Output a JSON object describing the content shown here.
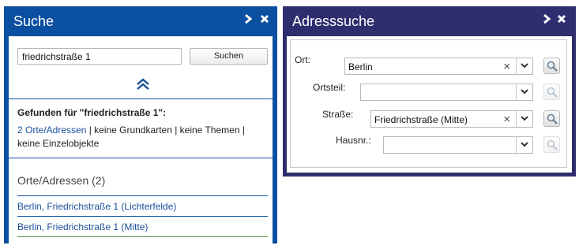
{
  "suche": {
    "title": "Suche",
    "search_value": "friedrichstraße 1",
    "search_button": "Suchen",
    "found_heading": "Gefunden für \"friedrichstraße 1\":",
    "result_link": "2 Orte/Adressen",
    "result_rest_line1": " | keine Grundkarten | keine Themen |",
    "result_rest_line2": "keine Einzelobjekte",
    "section_heading": "Orte/Adressen (2)",
    "results": [
      "Berlin, Friedrichstraße 1 (Lichterfelde)",
      "Berlin, Friedrichstraße 1 (Mitte)"
    ]
  },
  "adresssuche": {
    "title": "Adresssuche",
    "fields": [
      {
        "label": "Ort:",
        "value": "Berlin"
      },
      {
        "label": "Ortsteil:",
        "value": ""
      },
      {
        "label": "Straße:",
        "value": "Friedrichstraße (Mitte)"
      },
      {
        "label": "Hausnr.:",
        "value": ""
      }
    ]
  },
  "icons": {
    "expand": "chevron-right-icon",
    "close": "close-icon",
    "collapse": "double-chevron-up-icon",
    "clear": "clear-x-icon",
    "dropdown": "dropdown-arrow-icon",
    "search": "magnifier-icon"
  },
  "colors": {
    "suche_header": "#0b4fa0",
    "adress_header": "#2e2d6e",
    "link": "#1a4f9b"
  }
}
